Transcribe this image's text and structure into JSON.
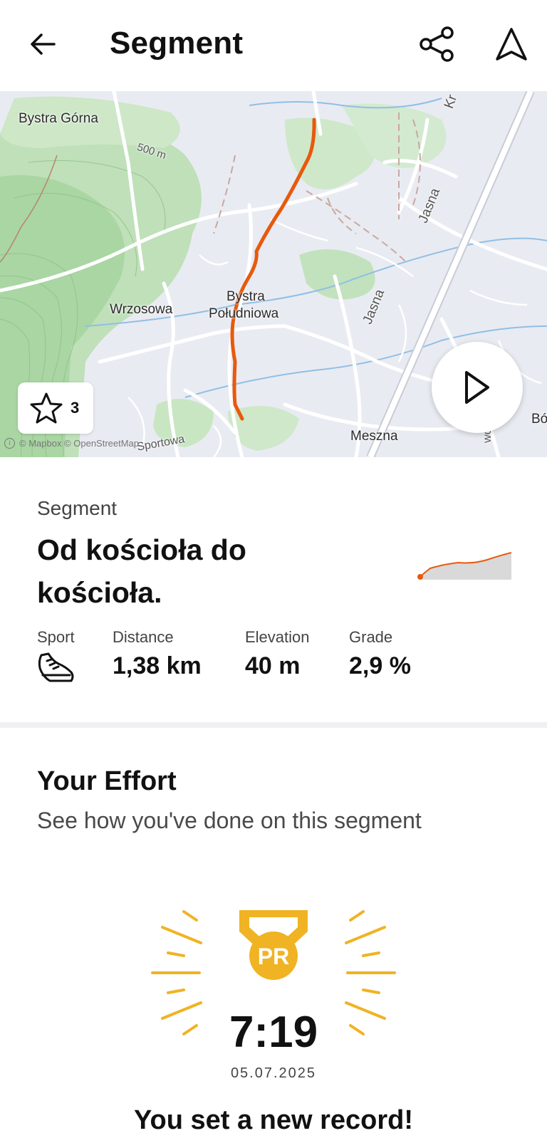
{
  "header": {
    "title": "Segment",
    "back_icon": "arrow-left-icon",
    "share_icon": "share-icon",
    "navigate_icon": "navigation-arrow-icon"
  },
  "map": {
    "labels": {
      "bystra_gorna": "Bystra Górna",
      "contour": "500 m",
      "bystra_poludniowa_1": "Bystra",
      "bystra_poludniowa_2": "Południowa",
      "wrzosowa": "Wrzosowa",
      "jasna_top": "Jasna",
      "jasna_mid": "Jasna",
      "meszna": "Meszna",
      "sportowa": "Sportowa",
      "bo": "Bó",
      "kr": "Kr",
      "wor": "wor"
    },
    "attribution": "© Mapbox © OpenStreetMap",
    "route_color": "#e8590c",
    "star_count": "3",
    "star_icon": "star-outline-icon",
    "play_icon": "play-icon"
  },
  "segment": {
    "kicker": "Segment",
    "name": "Od kościoła do kościoła.",
    "stats": [
      {
        "label": "Sport",
        "value": "",
        "icon": "running-shoe-icon"
      },
      {
        "label": "Distance",
        "value": "1,38 km"
      },
      {
        "label": "Elevation",
        "value": "40 m"
      },
      {
        "label": "Grade",
        "value": "2,9 %"
      }
    ]
  },
  "effort": {
    "title": "Your Effort",
    "subtitle": "See how you've done on this segment",
    "badge": "PR",
    "badge_color": "#f0b323",
    "time": "7:19",
    "date": "05.07.2025",
    "message": "You set a new record!"
  }
}
